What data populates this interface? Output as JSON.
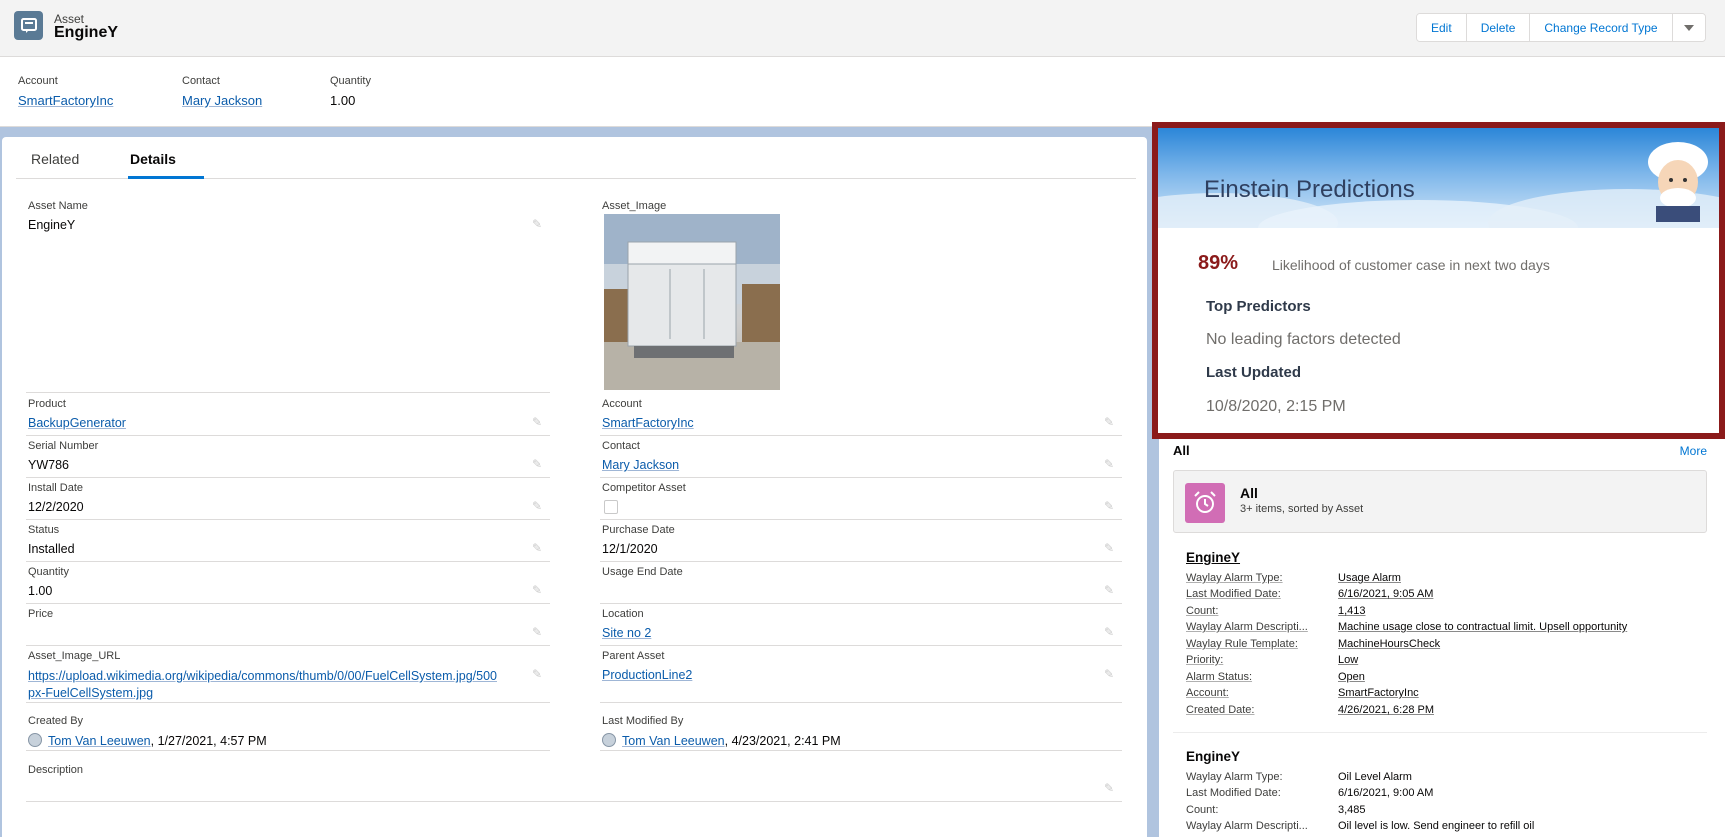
{
  "header": {
    "object_label": "Asset",
    "record_title": "EngineY",
    "buttons": [
      "Edit",
      "Delete",
      "Change Record Type"
    ]
  },
  "highlights": [
    {
      "label": "Account",
      "value": "SmartFactoryInc"
    },
    {
      "label": "Contact",
      "value": "Mary Jackson"
    },
    {
      "label": "Quantity",
      "value": "1.00"
    }
  ],
  "tabs": [
    "Related",
    "Details"
  ],
  "details": {
    "asset_name": {
      "label": "Asset Name",
      "value": "EngineY"
    },
    "asset_image": {
      "label": "Asset_Image"
    },
    "product": {
      "label": "Product",
      "value": "BackupGenerator"
    },
    "account": {
      "label": "Account",
      "value": "SmartFactoryInc"
    },
    "serial_number": {
      "label": "Serial Number",
      "value": "YW786"
    },
    "contact": {
      "label": "Contact",
      "value": "Mary Jackson"
    },
    "install_date": {
      "label": "Install Date",
      "value": "12/2/2020"
    },
    "competitor_asset": {
      "label": "Competitor Asset"
    },
    "status": {
      "label": "Status",
      "value": "Installed"
    },
    "purchase_date": {
      "label": "Purchase Date",
      "value": "12/1/2020"
    },
    "quantity": {
      "label": "Quantity",
      "value": "1.00"
    },
    "usage_end_date": {
      "label": "Usage End Date",
      "value": ""
    },
    "price": {
      "label": "Price",
      "value": ""
    },
    "location": {
      "label": "Location",
      "value": "Site no 2"
    },
    "asset_image_url": {
      "label": "Asset_Image_URL",
      "line1": "https://upload.wikimedia.org/wikipedia/commons/thumb/0/00/FuelCellSystem.jpg/500",
      "line2": "px-FuelCellSystem.jpg"
    },
    "parent_asset": {
      "label": "Parent Asset",
      "value": "ProductionLine2"
    },
    "created_by": {
      "label": "Created By",
      "user": "Tom Van Leeuwen",
      "date": ", 1/27/2021, 4:57 PM"
    },
    "last_modified_by": {
      "label": "Last Modified By",
      "user": "Tom Van Leeuwen",
      "date": ", 4/23/2021, 2:41 PM"
    },
    "description": {
      "label": "Description",
      "value": ""
    }
  },
  "einstein": {
    "title": "Einstein Predictions",
    "percent": "89%",
    "percent_desc": "Likelihood of customer case in next two days",
    "top_predictors_label": "Top Predictors",
    "top_predictors_value": "No leading factors detected",
    "last_updated_label": "Last Updated",
    "last_updated_value": "10/8/2020, 2:15 PM"
  },
  "related": {
    "title": "All",
    "more": "More",
    "list_title": "All",
    "list_sub": "3+ items, sorted by Asset",
    "records": [
      {
        "title": "EngineY",
        "rows": [
          {
            "k": "Waylay Alarm Type:",
            "v": "Usage Alarm"
          },
          {
            "k": "Last Modified Date:",
            "v": "6/16/2021, 9:05 AM"
          },
          {
            "k": "Count:",
            "v": "1,413"
          },
          {
            "k": "Waylay Alarm Descripti...",
            "v": "Machine usage close to contractual limit. Upsell opportunity"
          },
          {
            "k": "Waylay Rule Template:",
            "v": "MachineHoursCheck"
          },
          {
            "k": "Priority:",
            "v": "Low"
          },
          {
            "k": "Alarm Status:",
            "v": "Open"
          },
          {
            "k": "Account:",
            "v": "SmartFactoryInc"
          },
          {
            "k": "Created Date:",
            "v": "4/26/2021, 6:28 PM"
          }
        ]
      },
      {
        "title": "EngineY",
        "rows": [
          {
            "k": "Waylay Alarm Type:",
            "v": "Oil Level Alarm"
          },
          {
            "k": "Last Modified Date:",
            "v": "6/16/2021, 9:00 AM"
          },
          {
            "k": "Count:",
            "v": "3,485"
          },
          {
            "k": "Waylay Alarm Descripti...",
            "v": "Oil level is low. Send engineer to refill oil"
          }
        ]
      }
    ]
  },
  "colors": {
    "brand_blue": "#0176d3",
    "highlight_border": "#8b1a1a",
    "percent_red": "#8b1a1a",
    "list_icon_pink": "#d16db5"
  }
}
